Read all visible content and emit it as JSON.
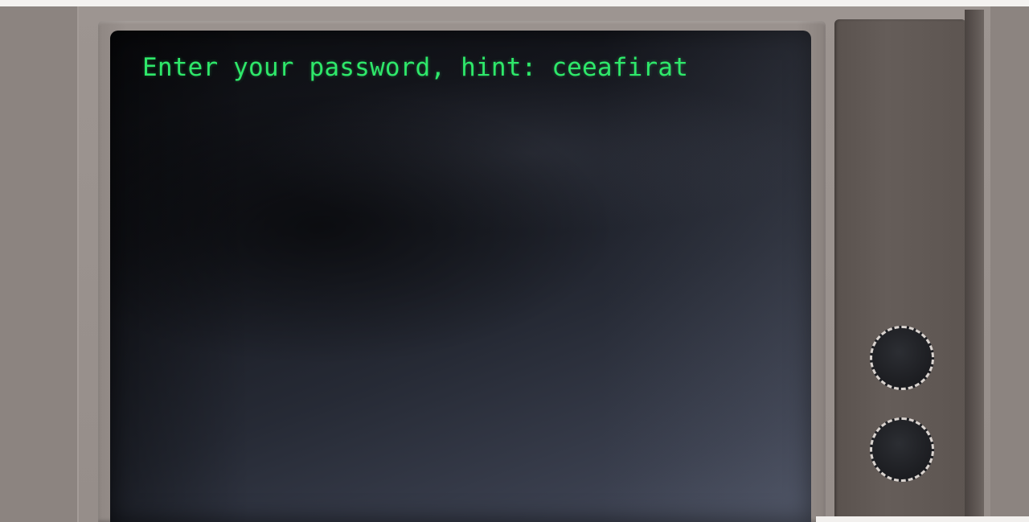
{
  "terminal": {
    "prompt_text": "Enter your password, hint: ceeafirat",
    "text_color": "#2ee86a"
  },
  "controls": {
    "knobs": [
      "knob-top",
      "knob-bottom"
    ]
  }
}
